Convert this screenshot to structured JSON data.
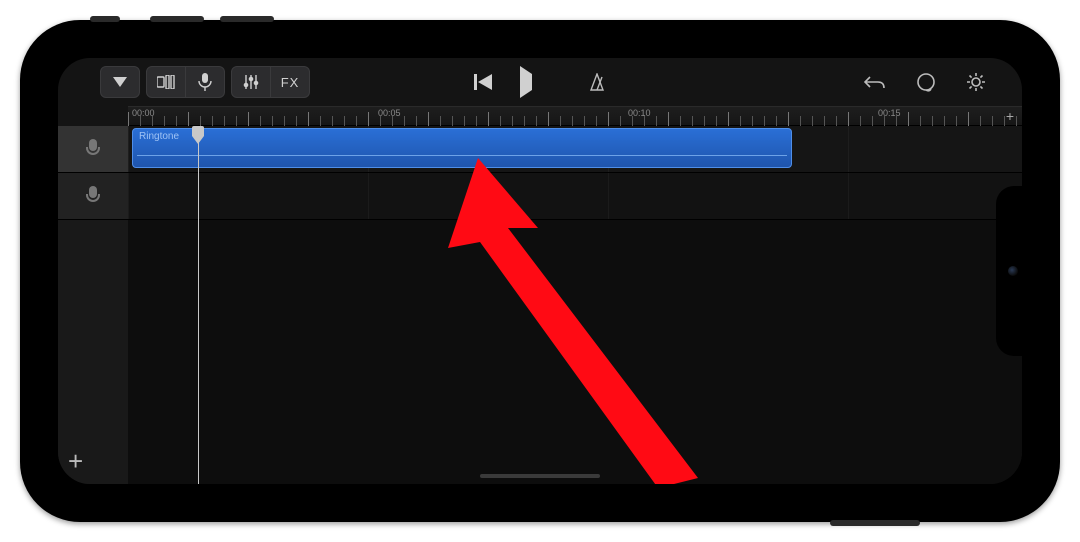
{
  "toolbar": {
    "fx_label": "FX"
  },
  "ruler": {
    "marks": [
      "00:00",
      "00:05",
      "00:10",
      "00:15"
    ],
    "plus": "+"
  },
  "tracks": {
    "region_label": "Ringtone",
    "add_label": "+"
  }
}
